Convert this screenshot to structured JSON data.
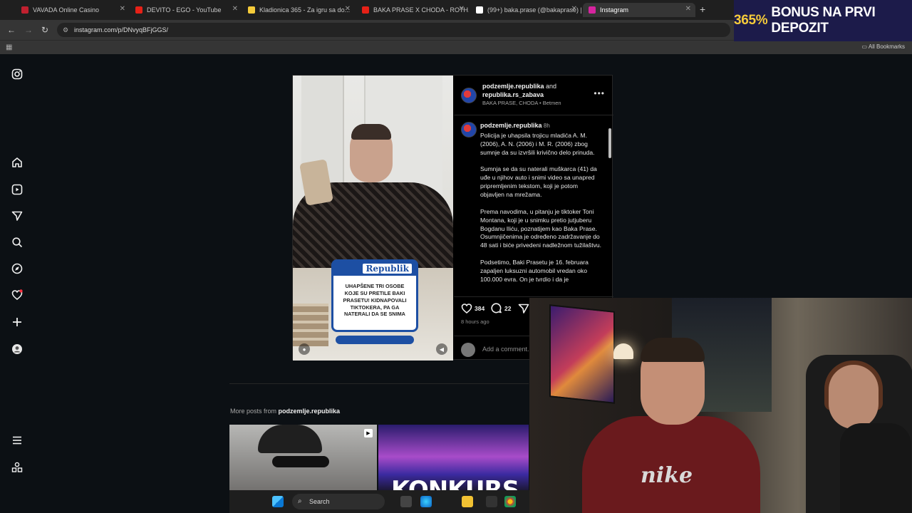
{
  "browser": {
    "tabs": [
      {
        "title": "VAVADA Online Casino",
        "color": "#c0202f"
      },
      {
        "title": "DEVITO - EGO - YouTube",
        "color": "#e62117"
      },
      {
        "title": "Kladionica 365 - Za igru sa do...",
        "color": "#f5cb3a"
      },
      {
        "title": "BAKA PRASE X CHODA - ROTH...",
        "color": "#e62117"
      },
      {
        "title": "(99+) baka.prase (@bakaprase) |",
        "color": "#ffffff"
      },
      {
        "title": "Instagram",
        "color": "#d6249f"
      }
    ],
    "url": "instagram.com/p/DNvyqBFjGGS/",
    "all_bookmarks": "All Bookmarks"
  },
  "ad_banner": {
    "highlight": "365%",
    "text": "BONUS NA PRVI DEPOZIT"
  },
  "sidebar_icons": [
    "instagram-icon",
    "home-icon",
    "reels-icon",
    "messages-icon",
    "search-icon",
    "explore-icon",
    "notifications-icon",
    "create-icon",
    "profile-icon",
    "menu-icon",
    "more-apps-icon"
  ],
  "post": {
    "author": "podzemlje.republika",
    "and_text": "and",
    "coauthor": "republika.rs_zabava",
    "audio": "BAKA PRASE, CHODA • Betmen",
    "caption_author": "podzemlje.republika",
    "caption_time": "8h",
    "caption_paragraphs": [
      "Policija je uhapsila trojicu mladića A. M. (2006), A. N. (2006) i M. R. (2006) zbog sumnje da su izvršili krivično delo prinuda.",
      "Sumnja se da su naterali muškarca (41) da uđe u njihov auto i snimi video sa unapred pripremljenim tekstom, koji je potom objavljen na mrežama.",
      "Prema navodima, u pitanju je tiktoker Toni Montana, koji je u snimku pretio jutjuberu Bogdanu Iliću, poznatijem kao Baka Prase. Osumnjičenima je određeno zadržavanje do 48 sati i biće privedeni nadležnom tužilaštvu.",
      "Podsetimo, Baki Prasetu je 16. februara zapaljen luksuzni automobil vredan oko 100.000 evra. On je tvrdio i da je"
    ],
    "likes": "384",
    "comments": "22",
    "time_ago": "8 hours ago",
    "comment_placeholder": "Add a comment...",
    "news_brand": "Republik",
    "news_headline": "UHAPŠENE TRI OSOBE KOJE SU PRETILE BAKI PRASETU! KIDNAPOVALI TIKTOKERA, PA GA NATERALI DA SE SNIMA"
  },
  "more_posts": {
    "prefix": "More posts from",
    "account": "podzemlje.republika",
    "thumb2_text": "KONKURS"
  },
  "webcam": {
    "shirt_text": "nike"
  },
  "taskbar": {
    "search": "Search"
  }
}
